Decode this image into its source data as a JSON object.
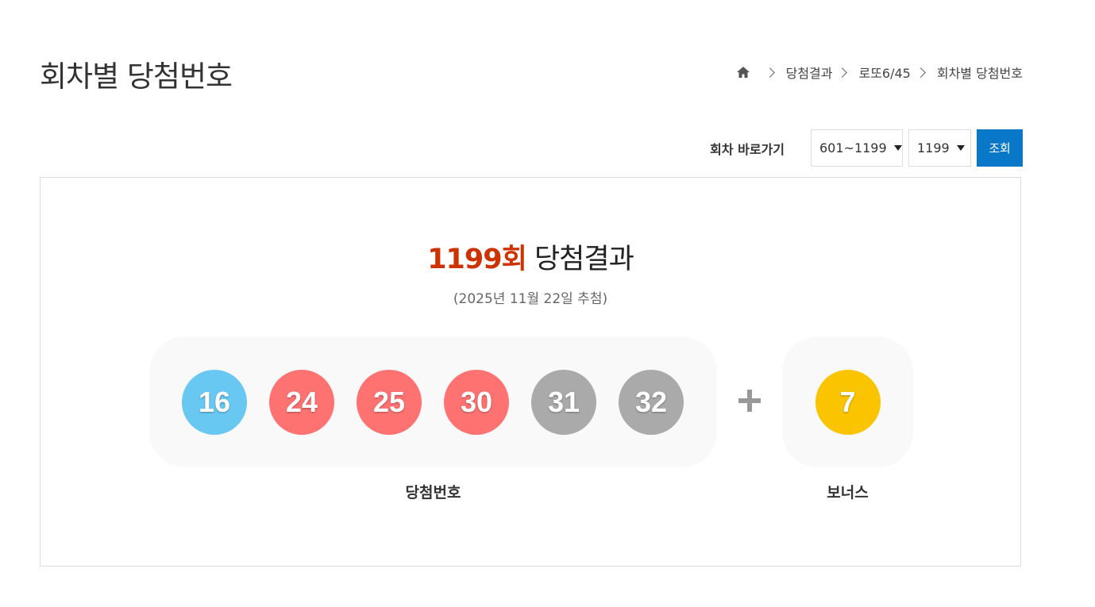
{
  "header": {
    "title": "회차별 당첨번호"
  },
  "breadcrumb": {
    "home_icon": "home-icon",
    "items": [
      "당첨결과",
      "로또6/45",
      "회차별 당첨번호"
    ]
  },
  "jump": {
    "label": "회차 바로가기",
    "range_value": "601~1199",
    "round_value": "1199",
    "search_label": "조회"
  },
  "result": {
    "round_text": "1199회",
    "title_suffix": "당첨결과",
    "date_text": "(2025년 11월 22일 추첨)",
    "winning_numbers": [
      {
        "number": "16",
        "color": "#69c8f2"
      },
      {
        "number": "24",
        "color": "#ff7272"
      },
      {
        "number": "25",
        "color": "#ff7272"
      },
      {
        "number": "30",
        "color": "#ff7272"
      },
      {
        "number": "31",
        "color": "#aaaaaa"
      },
      {
        "number": "32",
        "color": "#aaaaaa"
      }
    ],
    "bonus_number": {
      "number": "7",
      "color": "#fbc400"
    },
    "winning_label": "당첨번호",
    "bonus_label": "보너스"
  },
  "colors": {
    "accent": "#cc3300",
    "button": "#0a78c8"
  }
}
